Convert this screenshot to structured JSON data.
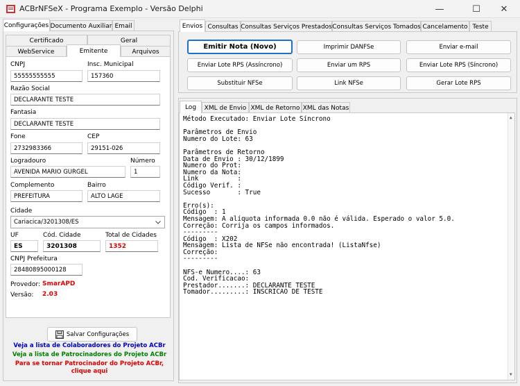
{
  "window": {
    "title": "ACBrNFSeX - Programa Exemplo - Versão Delphi",
    "buttons": [
      "—",
      "☐",
      "✕"
    ]
  },
  "left_tabs": [
    "Configurações",
    "Documento Auxiliar",
    "Email"
  ],
  "sub_tabs_row1": [
    "Certificado",
    "Geral"
  ],
  "sub_tabs_row2": [
    "WebService",
    "Emitente",
    "Arquivos"
  ],
  "emitente": {
    "cnpj_label": "CNPJ",
    "cnpj": "55555555555",
    "im_label": "Insc. Municipal",
    "im": "157360",
    "razao_label": "Razão Social",
    "razao": "DECLARANTE TESTE",
    "fantasia_label": "Fantasia",
    "fantasia": "DECLARANTE TESTE",
    "fone_label": "Fone",
    "fone": "2732983366",
    "cep_label": "CEP",
    "cep": "29151-026",
    "logradouro_label": "Logradouro",
    "logradouro": "AVENIDA MARIO GURGEL",
    "numero_label": "Número",
    "numero": "1",
    "complemento_label": "Complemento",
    "complemento": "PREFEITURA",
    "bairro_label": "Bairro",
    "bairro": "ALTO LAGE",
    "cidade_label": "Cidade",
    "cidade": "Cariacica/3201308/ES",
    "uf_label": "UF",
    "uf": "ES",
    "cod_cidade_label": "Cód. Cidade",
    "cod_cidade": "3201308",
    "total_cidades_label": "Total de Cidades",
    "total_cidades": "1352",
    "cnpj_pref_label": "CNPJ Prefeitura",
    "cnpj_pref": "28480895000128",
    "provedor_label": "Provedor:",
    "provedor": "SmarAPD",
    "versao_label": "Versão:",
    "versao": "2.03"
  },
  "save_button": "Salvar Configurações",
  "links": {
    "colaboradores": "Veja a lista de Colaboradores do Projeto ACBr",
    "patrocinadores": "Veja a lista de Patrocinadores do Projeto ACBr",
    "tornar_line1": "Para se tornar Patrocinador do Projeto ACBr,",
    "tornar_line2": "clique aqui"
  },
  "right_tabs": [
    "Envios",
    "Consultas",
    "Consultas Serviços Prestados",
    "Consultas Serviços Tomados",
    "Cancelamento",
    "Teste"
  ],
  "actions": [
    "Emitir Nota (Novo)",
    "Imprimir DANFSe",
    "Enviar e-mail",
    "Enviar Lote RPS (Assíncrono)",
    "Enviar um RPS",
    "Enviar Lote RPS (Síncrono)",
    "Substituir NFSe",
    "Link NFSe",
    "Gerar Lote RPS"
  ],
  "log_tabs": [
    "Log",
    "XML de Envio",
    "XML de Retorno",
    "XML das Notas"
  ],
  "log_lines": [
    "Método Executado: Enviar Lote Síncrono",
    "",
    "Parâmetros de Envio",
    "Numero do Lote: 63",
    "",
    "Parâmetros de Retorno",
    "Data de Envio : 30/12/1899",
    "Numero do Prot:",
    "Numero da Nota:",
    "Link          :",
    "Código Verif. :",
    "Sucesso       : True",
    "",
    "Erro(s):",
    "Código  : 1",
    "Mensagem: A alíquota informada 0.0 não é válida. Esperado o valor 5.0.",
    "Correção: Corrija os campos informados.",
    "---------",
    "Código  : X202",
    "Mensagem: Lista de NFSe não encontrada! (ListaNfse)",
    "Correção:",
    "---------",
    "",
    "NFS-e Numero....: 63",
    "Cod. Verificacao:",
    "Prestador.......: DECLARANTE TESTE",
    "Tomador.........: INSCRICAO DE TESTE"
  ],
  "colors": {
    "primary_border": "#1f6fd1",
    "red_value": "#e00000",
    "link_blue": "#0000cc",
    "link_green": "#008000",
    "link_red": "#e00000"
  }
}
